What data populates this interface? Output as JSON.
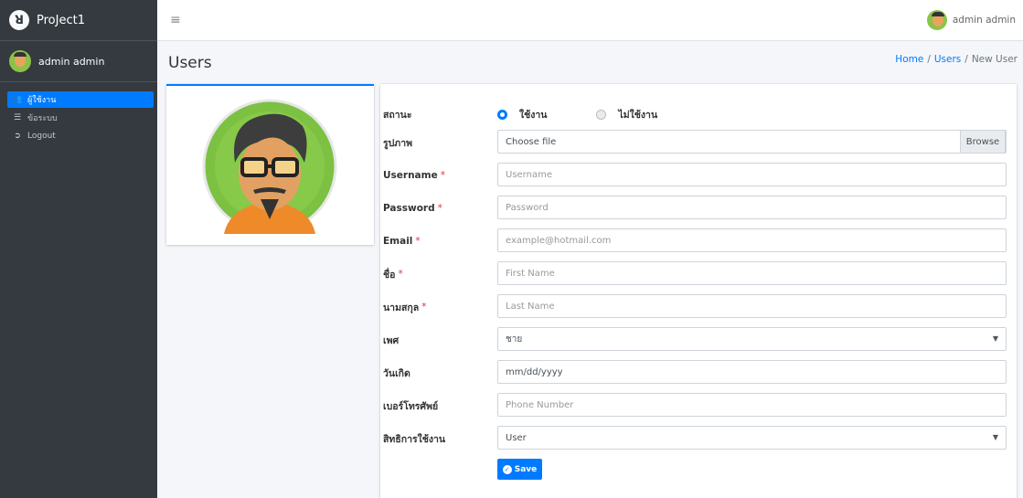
{
  "brand": {
    "name": "ProJect1"
  },
  "sidebar": {
    "user_name": "admin admin",
    "items": [
      {
        "label": "ผู้ใช้งาน",
        "icon": "users-icon",
        "active": true
      },
      {
        "label": "ข้อระบบ",
        "icon": "list-icon",
        "active": false
      },
      {
        "label": "Logout",
        "icon": "sign-out-icon",
        "active": false
      }
    ]
  },
  "topbar": {
    "user_name": "admin admin"
  },
  "header": {
    "title": "Users",
    "breadcrumb": [
      "Home",
      "Users",
      "New User"
    ]
  },
  "form": {
    "status": {
      "label": "สถานะ",
      "options": [
        "ใช้งาน",
        "ไม่ใช้งาน"
      ],
      "selected": "ใช้งาน"
    },
    "picture": {
      "label": "รูปภาพ",
      "value": "Choose file",
      "browse": "Browse"
    },
    "username": {
      "label": "Username",
      "placeholder": "Username"
    },
    "password": {
      "label": "Password",
      "placeholder": "Password"
    },
    "email": {
      "label": "Email",
      "placeholder": "example@hotmail.com"
    },
    "first_name": {
      "label": "ชื่อ",
      "placeholder": "First Name"
    },
    "last_name": {
      "label": "นามสกุล",
      "placeholder": "Last Name"
    },
    "gender": {
      "label": "เพศ",
      "value": "ชาย"
    },
    "birthday": {
      "label": "วันเกิด",
      "value": "mm/dd/yyyy"
    },
    "phone": {
      "label": "เบอร์โทรศัพย์",
      "placeholder": "Phone Number"
    },
    "role": {
      "label": "สิทธิการใช้งาน",
      "value": "User"
    },
    "required_mark": "*",
    "save_label": "Save"
  },
  "colors": {
    "primary": "#007bff",
    "sidebar": "#343a40",
    "required": "#dc3545"
  }
}
